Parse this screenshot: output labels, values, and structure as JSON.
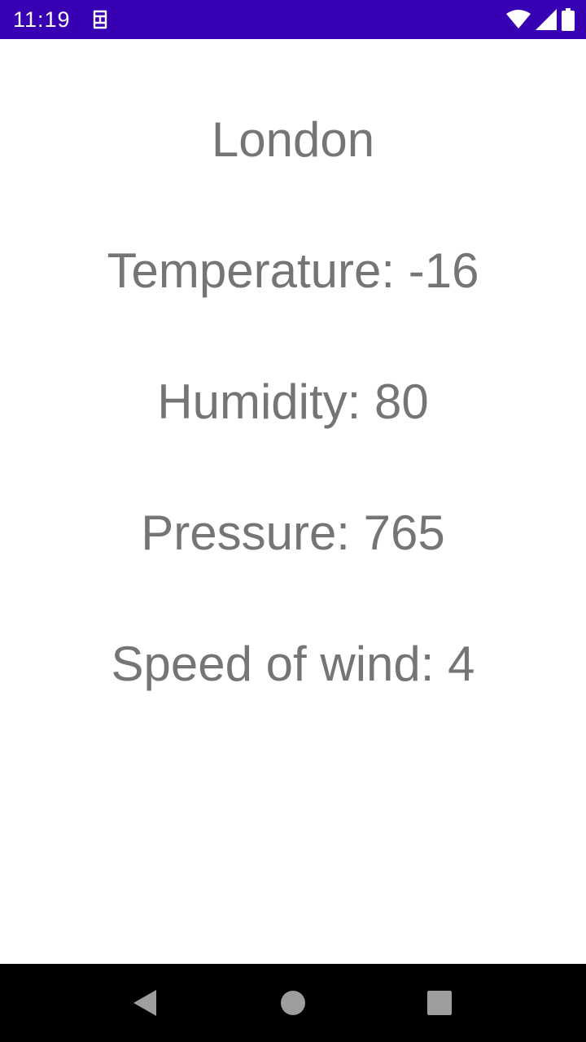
{
  "status_bar": {
    "time": "11:19",
    "icons": [
      "sim-card-icon",
      "wifi-icon",
      "cell-signal-icon",
      "battery-icon"
    ],
    "background_color": "#3700b3"
  },
  "weather": {
    "city": "London",
    "temperature": "Temperature: -16",
    "humidity": "Humidity: 80",
    "pressure": "Pressure: 765",
    "wind_speed": "Speed of wind: 4",
    "text_color": "#757575"
  },
  "nav_bar": {
    "buttons": [
      "back-icon",
      "home-icon",
      "recents-icon"
    ]
  }
}
